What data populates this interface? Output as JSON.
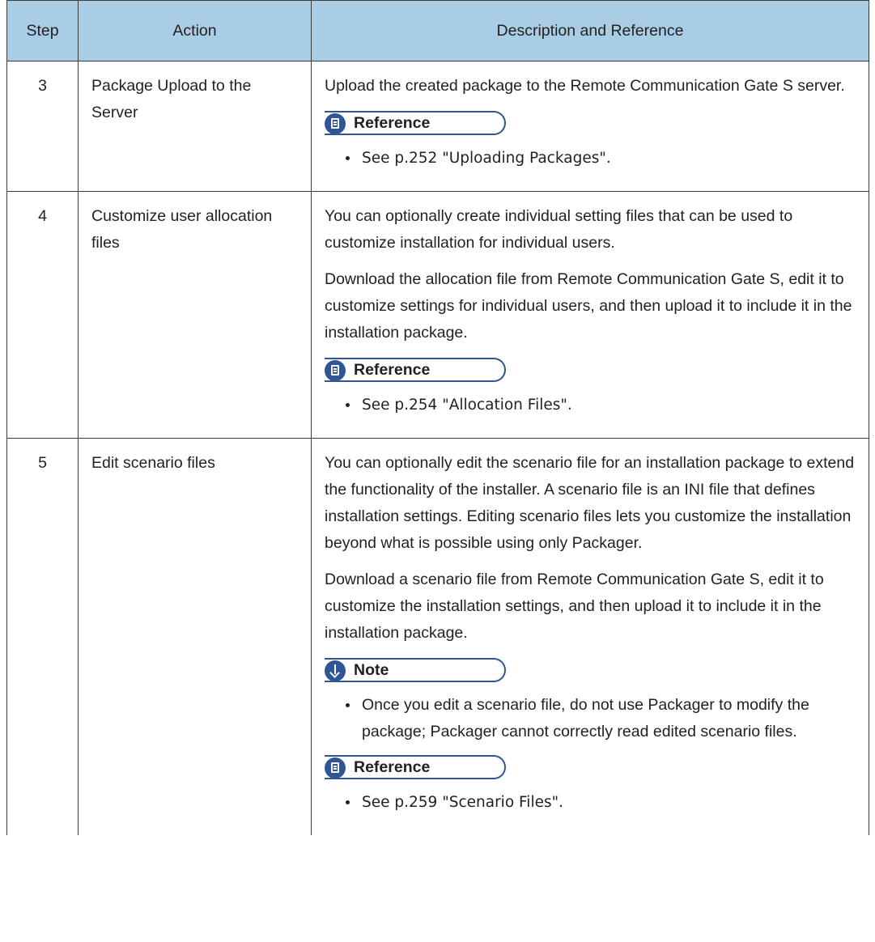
{
  "table": {
    "headers": {
      "step": "Step",
      "action": "Action",
      "description": "Description and Reference"
    },
    "rows": [
      {
        "step": "3",
        "action": "Package Upload to the Server",
        "paragraphs": [
          "Upload the created package to the Remote Communication Gate S server."
        ],
        "reference_label": "Reference",
        "reference_item": "See p.252 \"Uploading Packages\"."
      },
      {
        "step": "4",
        "action": "Customize user allocation files",
        "paragraphs": [
          "You can optionally create individual setting files that can be used to customize installation for individual users.",
          "Download the allocation file from Remote Communication Gate S, edit it to customize settings for individual users, and then upload it to include it in the installation package."
        ],
        "reference_label": "Reference",
        "reference_item": "See p.254 \"Allocation Files\"."
      },
      {
        "step": "5",
        "action": "Edit scenario files",
        "paragraphs": [
          "You can optionally edit the scenario file for an installation package to extend the functionality of the installer. A scenario file is an INI file that defines installation settings. Editing scenario files lets you customize the installation beyond what is possible using only Packager.",
          "Download a scenario file from Remote Communication Gate S, edit it to customize the installation settings, and then upload it to include it in the installation package."
        ],
        "note_label": "Note",
        "note_item": "Once you edit a scenario file, do not use Packager to modify the package; Packager cannot correctly read edited scenario files.",
        "reference_label": "Reference",
        "reference_item": "See p.259 \"Scenario Files\"."
      }
    ]
  },
  "colors": {
    "header_bg": "#a8cde5",
    "callout_accent": "#2f5596",
    "rule": "#3c3c3c"
  },
  "icons": {
    "reference": "reference-icon",
    "note": "note-icon"
  }
}
